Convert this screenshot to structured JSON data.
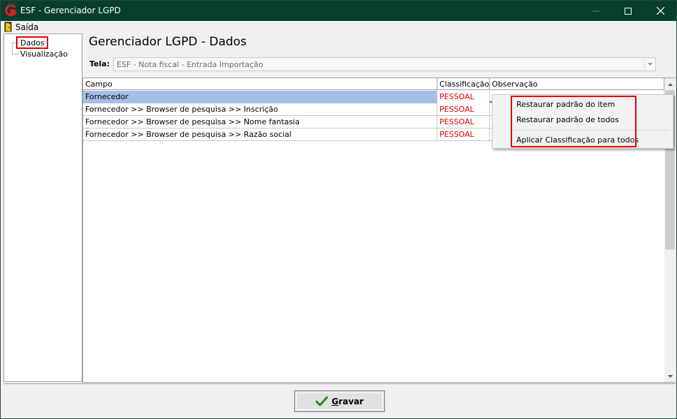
{
  "window": {
    "title": "ESF - Gerenciador LGPD",
    "colors": {
      "titlebar": "#073f2c",
      "accent_red": "#e00000",
      "selection": "#a6bde8"
    }
  },
  "menubar": {
    "items": [
      {
        "label": "Saída",
        "icon": "exit-door-icon"
      }
    ]
  },
  "tree": {
    "items": [
      {
        "label": "Dados",
        "highlighted": true
      },
      {
        "label": "Visualização"
      }
    ]
  },
  "header": {
    "title": "Gerenciador LGPD - Dados"
  },
  "tela": {
    "label": "Tela:",
    "value": "ESF - Nota fiscal - Entrada Importação"
  },
  "grid": {
    "columns": [
      "Campo",
      "Classificação",
      "Observação"
    ],
    "rows": [
      {
        "campo": "Fornecedor",
        "classificacao": "PESSOAL",
        "observacao": ""
      },
      {
        "campo": "Fornecedor >> Browser de pesquisa >> Inscrição",
        "classificacao": "PESSOAL",
        "observacao": ""
      },
      {
        "campo": "Fornecedor >> Browser de pesquisa >> Nome fantasia",
        "classificacao": "PESSOAL",
        "observacao": ""
      },
      {
        "campo": "Fornecedor >> Browser de pesquisa >> Razão social",
        "classificacao": "PESSOAL",
        "observacao": ""
      }
    ]
  },
  "context_menu": {
    "items": [
      "Restaurar padrão do item",
      "Restaurar padrão de todos",
      "Aplicar Classificação para todos"
    ]
  },
  "footer": {
    "save_button": {
      "prefix": "",
      "underlined": "G",
      "rest": "ravar",
      "icon": "checkmark-icon"
    }
  }
}
